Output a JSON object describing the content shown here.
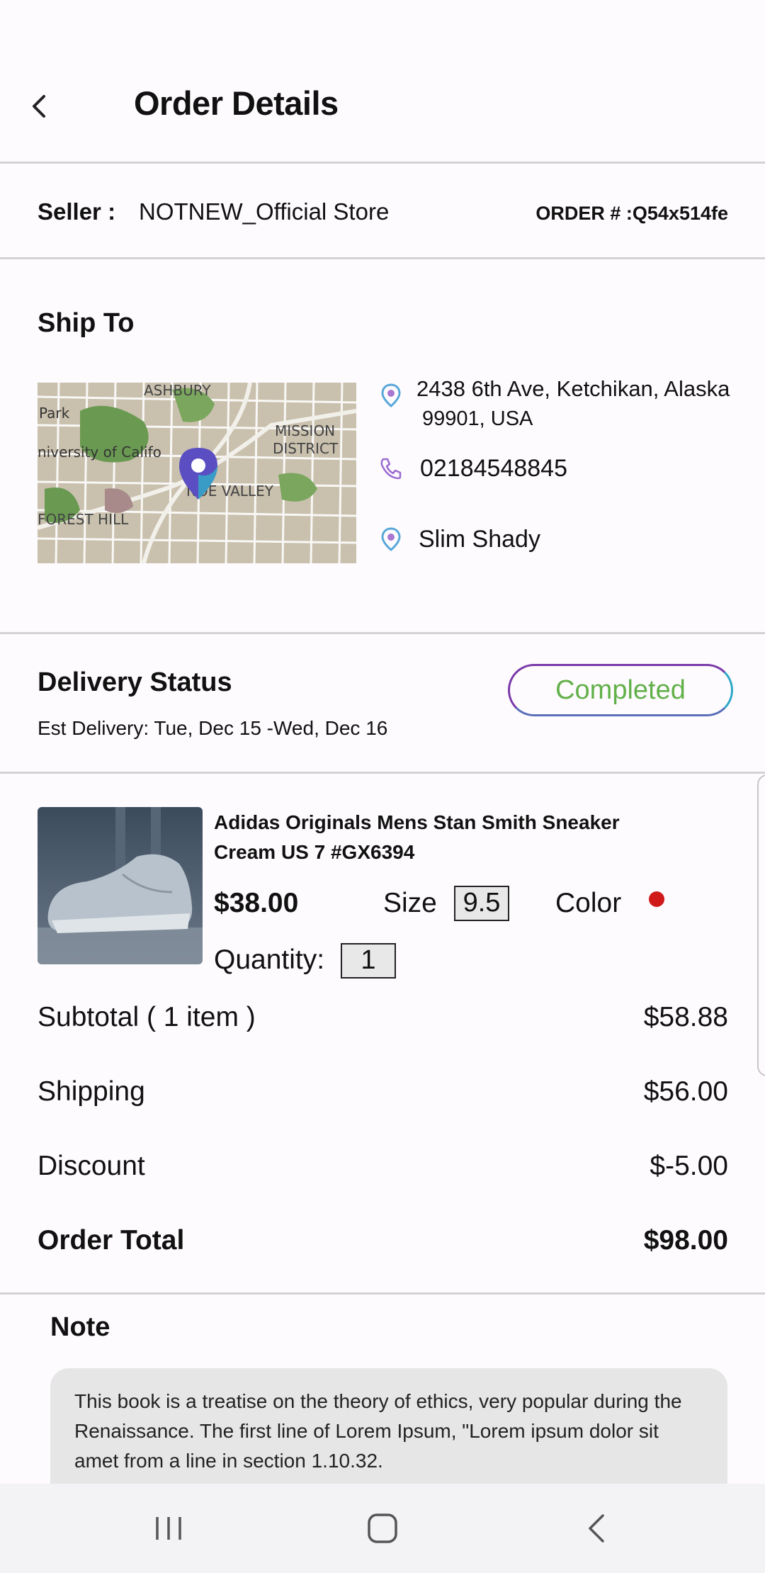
{
  "header": {
    "title": "Order Details"
  },
  "seller": {
    "label": "Seller :",
    "name": "NOTNEW_Official Store",
    "order_number": "ORDER # :Q54x514fe"
  },
  "ship_to": {
    "heading": "Ship To",
    "address_line1": "2438 6th Ave, Ketchikan, Alaska",
    "address_line2": "99901, USA",
    "phone": "02184548845",
    "recipient": "Slim Shady",
    "map_labels": {
      "ashbury": "ASHBURY",
      "park": "Park",
      "university": "niversity of Califo",
      "mission": "MISSION",
      "district": "DISTRICT",
      "noe_valley": "NOE VALLEY",
      "forest_hill": "FOREST HILL"
    }
  },
  "delivery": {
    "heading": "Delivery Status",
    "status": "Completed",
    "estimate": "Est Delivery: Tue, Dec 15 -Wed, Dec 16"
  },
  "product": {
    "name": "Adidas Originals Mens Stan Smith Sneaker Cream US 7 #GX6394",
    "price": "$38.00",
    "size_label": "Size",
    "size_value": "9.5",
    "color_label": "Color",
    "color_value": "#d01a1a",
    "quantity_label": "Quantity:",
    "quantity_value": "1"
  },
  "summary": {
    "subtotal_label": "Subtotal ( 1 item )",
    "subtotal_value": "$58.88",
    "shipping_label": "Shipping",
    "shipping_value": "$56.00",
    "discount_label": "Discount",
    "discount_value": "$-5.00",
    "total_label": "Order Total",
    "total_value": "$98.00"
  },
  "note": {
    "heading": "Note",
    "text": "This book is a treatise on the theory of ethics, very popular during the Renaissance. The first line of Lorem Ipsum, \"Lorem ipsum dolor sit amet from a line in section 1.10.32."
  },
  "navbar": {
    "recent": "recents-icon",
    "home": "home-icon",
    "back": "back-icon"
  },
  "colors": {
    "accent_purple": "#7a3aa8",
    "accent_cyan": "#2ea8c8",
    "status_green": "#62b04a"
  }
}
